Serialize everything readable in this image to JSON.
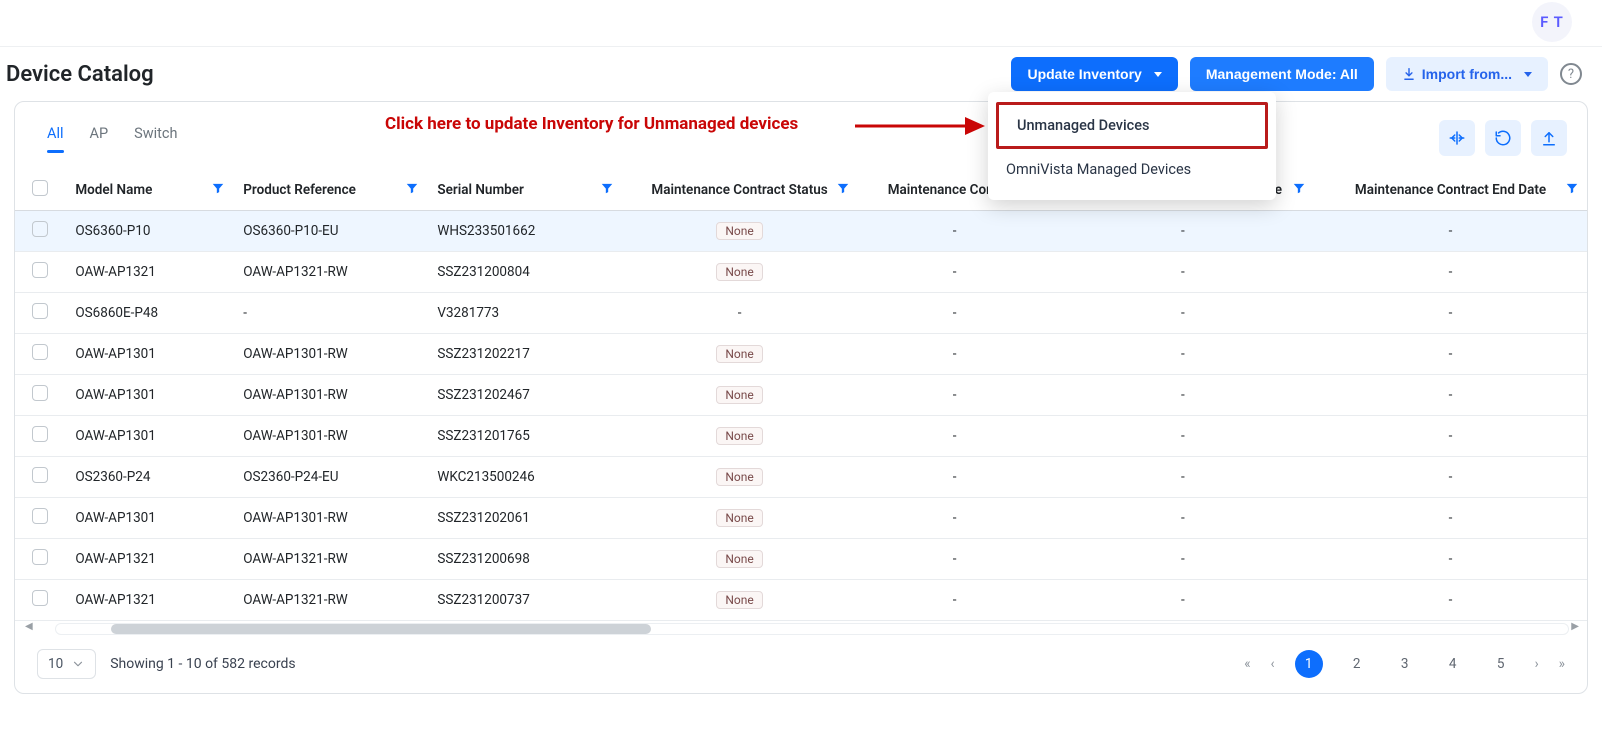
{
  "corner_initials": "F T",
  "page_title": "Device Catalog",
  "header_buttons": {
    "update_inventory": "Update Inventory",
    "management_mode": "Management Mode: All",
    "import_from": "Import from..."
  },
  "update_dropdown": {
    "item_unmanaged": "Unmanaged Devices",
    "item_managed": "OmniVista Managed Devices"
  },
  "annotation_text": "Click here to update Inventory for Unmanaged devices",
  "tabs": {
    "all": "All",
    "ap": "AP",
    "switch": "Switch"
  },
  "columns": {
    "model": "Model Name",
    "ref": "Product Reference",
    "serial": "Serial Number",
    "status": "Maintenance Contract Status",
    "contract": "Maintenance Contract",
    "start": "Maintenance Contract Start Date",
    "end": "Maintenance Contract End Date"
  },
  "status_none": "None",
  "dash": "-",
  "rows": [
    {
      "model": "OS6360-P10",
      "ref": "OS6360-P10-EU",
      "serial": "WHS233501662",
      "status": "None",
      "contract": "-",
      "start": "-",
      "end": "-"
    },
    {
      "model": "OAW-AP1321",
      "ref": "OAW-AP1321-RW",
      "serial": "SSZ231200804",
      "status": "None",
      "contract": "-",
      "start": "-",
      "end": "-"
    },
    {
      "model": "OS6860E-P48",
      "ref": "-",
      "serial": "V3281773",
      "status": "-",
      "contract": "-",
      "start": "-",
      "end": "-"
    },
    {
      "model": "OAW-AP1301",
      "ref": "OAW-AP1301-RW",
      "serial": "SSZ231202217",
      "status": "None",
      "contract": "-",
      "start": "-",
      "end": "-"
    },
    {
      "model": "OAW-AP1301",
      "ref": "OAW-AP1301-RW",
      "serial": "SSZ231202467",
      "status": "None",
      "contract": "-",
      "start": "-",
      "end": "-"
    },
    {
      "model": "OAW-AP1301",
      "ref": "OAW-AP1301-RW",
      "serial": "SSZ231201765",
      "status": "None",
      "contract": "-",
      "start": "-",
      "end": "-"
    },
    {
      "model": "OS2360-P24",
      "ref": "OS2360-P24-EU",
      "serial": "WKC213500246",
      "status": "None",
      "contract": "-",
      "start": "-",
      "end": "-"
    },
    {
      "model": "OAW-AP1301",
      "ref": "OAW-AP1301-RW",
      "serial": "SSZ231202061",
      "status": "None",
      "contract": "-",
      "start": "-",
      "end": "-"
    },
    {
      "model": "OAW-AP1321",
      "ref": "OAW-AP1321-RW",
      "serial": "SSZ231200698",
      "status": "None",
      "contract": "-",
      "start": "-",
      "end": "-"
    },
    {
      "model": "OAW-AP1321",
      "ref": "OAW-AP1321-RW",
      "serial": "SSZ231200737",
      "status": "None",
      "contract": "-",
      "start": "-",
      "end": "-"
    }
  ],
  "footer": {
    "page_size": "10",
    "records_text": "Showing 1 - 10 of 582 records",
    "pages": [
      "1",
      "2",
      "3",
      "4",
      "5"
    ]
  }
}
